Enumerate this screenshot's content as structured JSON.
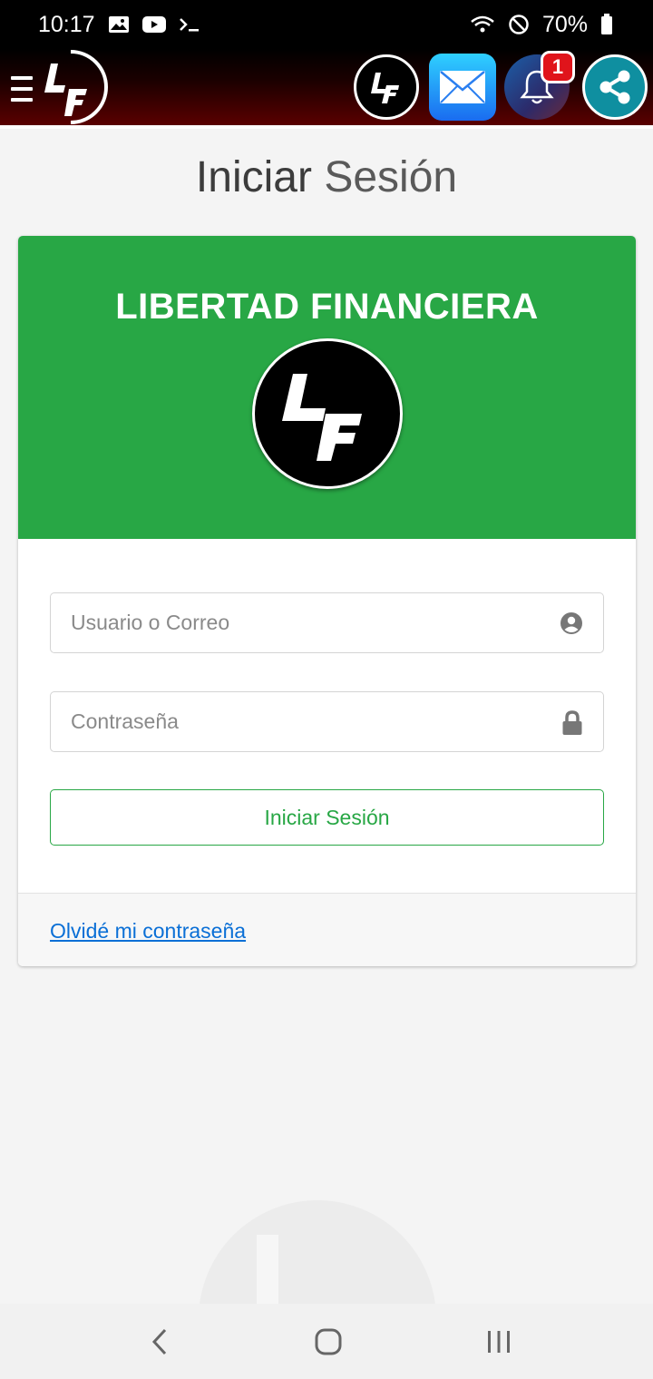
{
  "status_bar": {
    "time": "10:17",
    "battery": "70%",
    "icons": [
      "image-icon",
      "youtube-icon",
      "terminal-icon",
      "wifi-icon",
      "do-not-disturb-icon",
      "battery-icon"
    ]
  },
  "header": {
    "menu_icon": "hamburger-icon",
    "logo_text": "LF",
    "actions": [
      "lf-logo-button",
      "mail-button",
      "notifications-button",
      "share-button"
    ],
    "notification_count": "1"
  },
  "page": {
    "title_bold": "Iniciar",
    "title_light": "Sesión"
  },
  "card": {
    "brand_title": "LIBERTAD FINANCIERA",
    "username_placeholder": "Usuario o Correo",
    "password_placeholder": "Contraseña",
    "login_button": "Iniciar Sesión",
    "forgot_link": "Olvidé mi contraseña"
  },
  "colors": {
    "brand_green": "#28a745",
    "header_dark_red": "#5a0000",
    "link_blue": "#0a6fd6",
    "badge_red": "#e0141b"
  },
  "nav": [
    "back-icon",
    "home-icon",
    "recents-icon"
  ]
}
